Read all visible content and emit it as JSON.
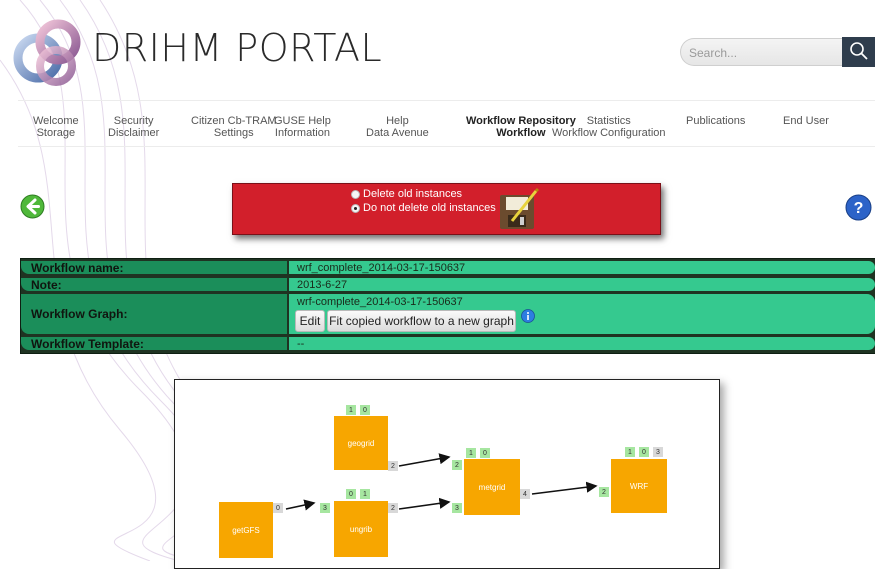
{
  "header": {
    "logo_text": "DRIHM PORTAL",
    "search_placeholder": "Search..."
  },
  "nav": [
    {
      "label": "Welcome\nStorage",
      "active": false
    },
    {
      "label": "Security\nDisclaimer",
      "active": false
    },
    {
      "label": "Citizen Cb-TRAM\nSettings",
      "active": false
    },
    {
      "label": "GUSE Help\nInformation",
      "active": false
    },
    {
      "label": "Help\nData Avenue",
      "active": false
    },
    {
      "label": "Workflow Repository\nWorkflow",
      "active": true
    },
    {
      "label": "Statistics\nWorkflow Configuration",
      "active": false
    },
    {
      "label": "Publications",
      "active": false
    },
    {
      "label": "End User",
      "active": false
    }
  ],
  "options": {
    "delete_old": "Delete old instances",
    "keep_old": "Do not delete old instances",
    "selected": "keep_old"
  },
  "info": {
    "name_label": "Workflow name:",
    "name_value": "wrf_complete_2014-03-17-150637",
    "note_label": "Note:",
    "note_value": "2013-6-27",
    "graph_label": "Workflow Graph:",
    "graph_value": "wrf-complete_2014-03-17-150637",
    "edit_button": "Edit",
    "fit_button": "Fit copied workflow to a new graph",
    "template_label": "Workflow Template:",
    "template_value": "--"
  },
  "graph": {
    "nodes": [
      {
        "id": "geogrid",
        "label": "geogrid"
      },
      {
        "id": "getGFS",
        "label": "getGFS"
      },
      {
        "id": "ungrib",
        "label": "ungrib"
      },
      {
        "id": "metgrid",
        "label": "metgrid"
      },
      {
        "id": "WRF",
        "label": "WRF"
      }
    ],
    "ports": {
      "geogrid_in": [
        "1",
        "0"
      ],
      "geogrid_out": "2",
      "ungrib_in_top": [
        "0",
        "1"
      ],
      "ungrib_in": "3",
      "ungrib_out": "2",
      "getGFS_out": "0",
      "metgrid_in_top": [
        "1",
        "0"
      ],
      "metgrid_in1": "2",
      "metgrid_in2": "3",
      "metgrid_out": "4",
      "wrf_in_top": [
        "1",
        "0",
        "3"
      ],
      "wrf_in": "2"
    }
  },
  "colors": {
    "red_panel": "#d21f2b",
    "table_label": "#1b8e5a",
    "table_value": "#35c98f",
    "node": "#f7a600"
  }
}
